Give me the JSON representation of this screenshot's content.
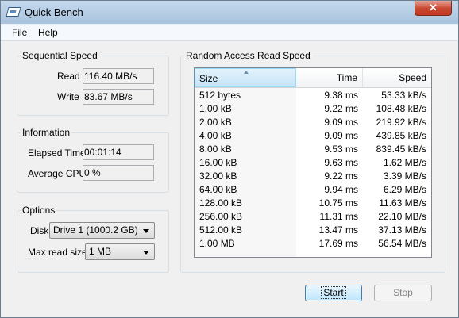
{
  "window": {
    "title": "Quick Bench",
    "close": "✕"
  },
  "menu": {
    "file": "File",
    "help": "Help"
  },
  "sequential": {
    "legend": "Sequential Speed",
    "read_label": "Read",
    "read_value": "116.40 MB/s",
    "write_label": "Write",
    "write_value": "83.67 MB/s"
  },
  "information": {
    "legend": "Information",
    "elapsed_label": "Elapsed Time",
    "elapsed_value": "00:01:14",
    "cpu_label": "Average CPU",
    "cpu_value": "0 %"
  },
  "options": {
    "legend": "Options",
    "disk_label": "Disk",
    "disk_value": "Drive 1 (1000.2 GB)",
    "maxread_label": "Max read size",
    "maxread_value": "1 MB"
  },
  "random": {
    "legend": "Random Access Read Speed",
    "columns": {
      "size": "Size",
      "time": "Time",
      "speed": "Speed"
    },
    "rows": [
      {
        "size": "512 bytes",
        "time": "9.38 ms",
        "speed": "53.33 kB/s"
      },
      {
        "size": "1.00 kB",
        "time": "9.22 ms",
        "speed": "108.48 kB/s"
      },
      {
        "size": "2.00 kB",
        "time": "9.09 ms",
        "speed": "219.92 kB/s"
      },
      {
        "size": "4.00 kB",
        "time": "9.09 ms",
        "speed": "439.85 kB/s"
      },
      {
        "size": "8.00 kB",
        "time": "9.53 ms",
        "speed": "839.45 kB/s"
      },
      {
        "size": "16.00 kB",
        "time": "9.63 ms",
        "speed": "1.62 MB/s"
      },
      {
        "size": "32.00 kB",
        "time": "9.22 ms",
        "speed": "3.39 MB/s"
      },
      {
        "size": "64.00 kB",
        "time": "9.94 ms",
        "speed": "6.29 MB/s"
      },
      {
        "size": "128.00 kB",
        "time": "10.75 ms",
        "speed": "11.63 MB/s"
      },
      {
        "size": "256.00 kB",
        "time": "11.31 ms",
        "speed": "22.10 MB/s"
      },
      {
        "size": "512.00 kB",
        "time": "13.47 ms",
        "speed": "37.13 MB/s"
      },
      {
        "size": "1.00 MB",
        "time": "17.69 ms",
        "speed": "56.54 MB/s"
      }
    ]
  },
  "buttons": {
    "start": "Start",
    "stop": "Stop"
  }
}
